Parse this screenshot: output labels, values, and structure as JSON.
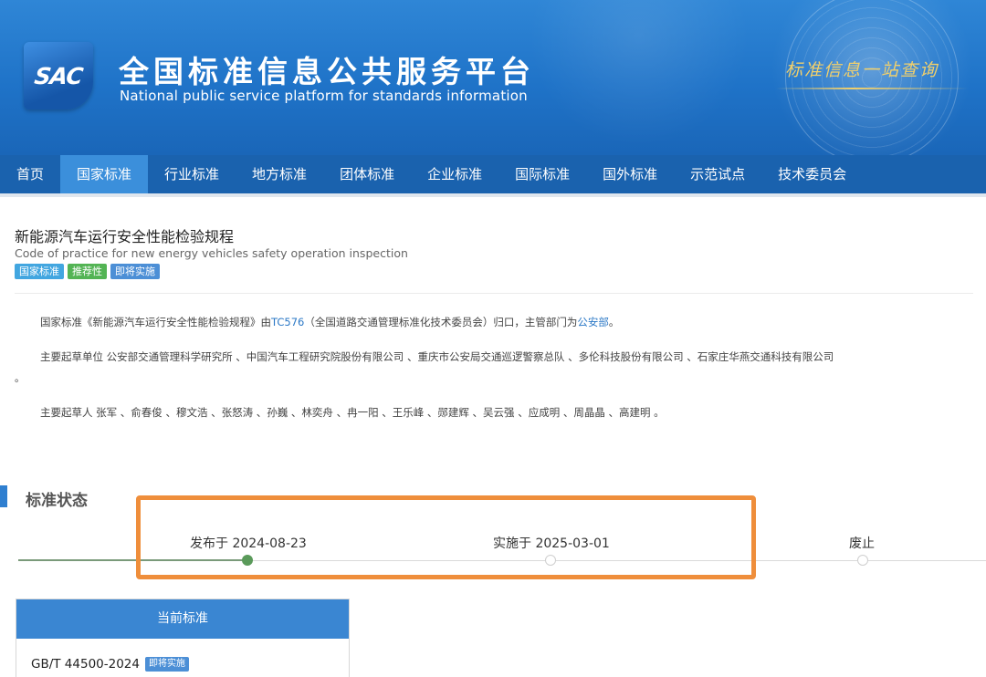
{
  "header": {
    "logo_text": "SAC",
    "title_cn": "全国标准信息公共服务平台",
    "title_en": "National public service platform  for standards information",
    "slogan": "标准信息一站查询"
  },
  "nav": {
    "items": [
      {
        "label": "首页"
      },
      {
        "label": "国家标准"
      },
      {
        "label": "行业标准"
      },
      {
        "label": "地方标准"
      },
      {
        "label": "团体标准"
      },
      {
        "label": "企业标准"
      },
      {
        "label": "国际标准"
      },
      {
        "label": "国外标准"
      },
      {
        "label": "示范试点"
      },
      {
        "label": "技术委员会"
      }
    ],
    "active_index": 1
  },
  "standard": {
    "title_cn": "新能源汽车运行安全性能检验规程",
    "title_en": "Code of practice for new energy vehicles safety operation inspection",
    "badges": [
      "国家标准",
      "推荐性",
      "即将实施"
    ]
  },
  "description": {
    "p1_prefix": "国家标准《新能源汽车运行安全性能检验规程》由",
    "p1_tc": "TC576",
    "p1_middle": "（全国道路交通管理标准化技术委员会）归口，主管部门为",
    "p1_dept": "公安部",
    "p1_suffix": "。",
    "p2": "主要起草单位 公安部交通管理科学研究所 、中国汽车工程研究院股份有限公司 、重庆市公安局交通巡逻警察总队 、多伦科技股份有限公司 、石家庄华燕交通科技有限公司",
    "p2_tail": "。",
    "p3": "主要起草人 张军 、俞春俊 、穆文浩 、张怒涛 、孙巍 、林奕舟 、冉一阳 、王乐峰 、郧建辉 、吴云强 、应成明 、周晶晶 、高建明 。"
  },
  "status": {
    "section_title": "标准状态",
    "steps": [
      {
        "label": "发布于 2024-08-23",
        "done": true
      },
      {
        "label": "实施于 2025-03-01",
        "done": false
      },
      {
        "label": "废止",
        "done": false
      }
    ]
  },
  "current": {
    "header": "当前标准",
    "code": "GB/T 44500-2024",
    "badge": "即将实施"
  },
  "colors": {
    "banner": "#1f73c8",
    "nav": "#1a62ae",
    "nav_active": "#3b8fdb",
    "highlight": "#ef8e3b",
    "link": "#2b78c6"
  }
}
